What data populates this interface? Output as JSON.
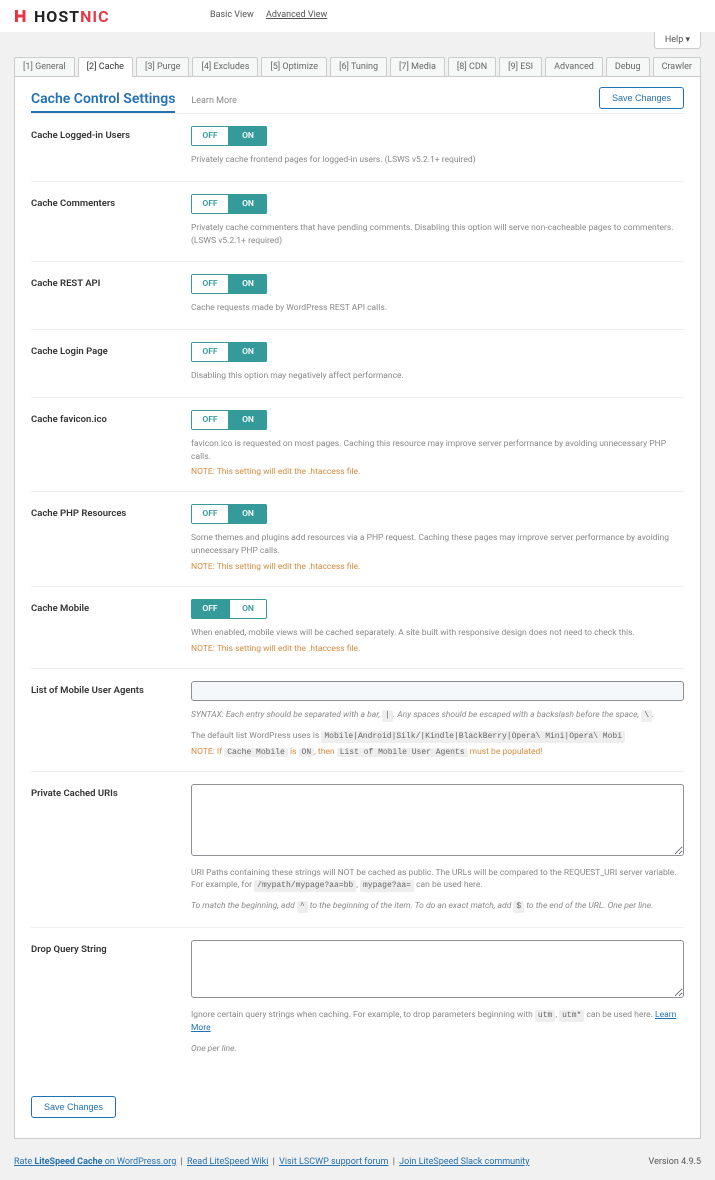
{
  "header": {
    "logo_host": "HOST",
    "logo_nic": "NIC",
    "views": {
      "basic": "Basic View",
      "advanced": "Advanced View"
    },
    "help": "Help ▾"
  },
  "tabs": {
    "items": [
      "[1] General",
      "[2] Cache",
      "[3] Purge",
      "[4] Excludes",
      "[5] Optimize",
      "[6] Tuning",
      "[7] Media",
      "[8] CDN",
      "[9] ESI",
      "Advanced",
      "Debug",
      "Crawler"
    ]
  },
  "panel": {
    "title": "Cache Control Settings",
    "learn_more": "Learn More",
    "save": "Save Changes"
  },
  "toggle_labels": {
    "off": "OFF",
    "on": "ON"
  },
  "settings": {
    "logged_in": {
      "label": "Cache Logged-in Users",
      "desc": "Privately cache frontend pages for logged-in users. (LSWS v5.2.1+ required)"
    },
    "commenters": {
      "label": "Cache Commenters",
      "desc": "Privately cache commenters that have pending comments. Disabling this option will serve non-cacheable pages to commenters. (LSWS v5.2.1+ required)"
    },
    "rest": {
      "label": "Cache REST API",
      "desc": "Cache requests made by WordPress REST API calls."
    },
    "login": {
      "label": "Cache Login Page",
      "desc": "Disabling this option may negatively affect performance."
    },
    "favicon": {
      "label": "Cache favicon.ico",
      "desc": "favicon.ico is requested on most pages. Caching this resource may improve server performance by avoiding unnecessary PHP calls.",
      "note": "NOTE: This setting will edit the .htaccess file."
    },
    "php": {
      "label": "Cache PHP Resources",
      "desc": "Some themes and plugins add resources via a PHP request. Caching these pages may improve server performance by avoiding unnecessary PHP calls.",
      "note": "NOTE: This setting will edit the .htaccess file."
    },
    "mobile": {
      "label": "Cache Mobile",
      "desc": "When enabled, mobile views will be cached separately. A site built with responsive design does not need to check this.",
      "note": "NOTE: This setting will edit the .htaccess file."
    },
    "mobile_agents": {
      "label": "List of Mobile User Agents",
      "syntax1_a": "SYNTAX: Each entry should be separated with a bar, ",
      "syntax1_bar": "|",
      "syntax1_b": ". Any spaces should be escaped with a backslash before the space, ",
      "syntax1_bs": "\\",
      "syntax1_c": ".",
      "default_a": "The default list WordPress uses is ",
      "default_code": "Mobile|Android|Silk/|Kindle|BlackBerry|Opera\\ Mini|Opera\\ Mobi",
      "note_a": "NOTE: If ",
      "note_cm": "Cache Mobile",
      "note_b": " is ",
      "note_on": "ON",
      "note_c": ", then ",
      "note_field": "List of Mobile User Agents",
      "note_d": " must be populated!"
    },
    "private_uri": {
      "label": "Private Cached URIs",
      "desc_a": "URI Paths containing these strings will NOT be cached as public. The URLs will be compared to the REQUEST_URI server variable. For example, for ",
      "code1": "/mypath/mypage?aa=bb",
      "code_sep": ", ",
      "code2": "mypage?aa=",
      "desc_b": " can be used here.",
      "match_a": "To match the beginning, add ",
      "caret": "^",
      "match_b": " to the beginning of the item. To do an exact match, add ",
      "dollar": "$",
      "match_c": " to the end of the URL. One per line."
    },
    "drop_query": {
      "label": "Drop Query String",
      "desc_a": "Ignore certain query strings when caching. For example, to drop parameters beginning with ",
      "code1": "utm",
      "code_sep": ", ",
      "code2": "utm*",
      "desc_b": " can be used here. ",
      "learn": "Learn More",
      "line": "One per line."
    }
  },
  "footer": {
    "rate_a": "Rate ",
    "rate_b": "LiteSpeed Cache",
    "rate_c": " on WordPress.org",
    "wiki": "Read LiteSpeed Wiki",
    "forum": "Visit LSCWP support forum",
    "slack": "Join LiteSpeed Slack community",
    "version": "Version 4.9.5"
  }
}
